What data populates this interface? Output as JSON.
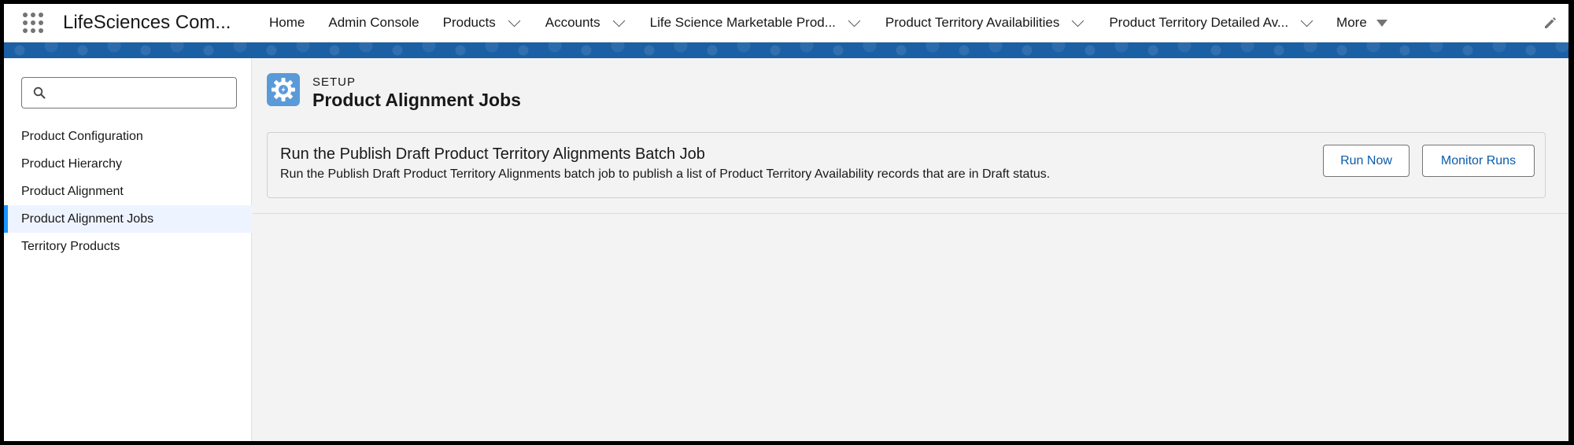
{
  "app": {
    "name": "LifeSciences Com..."
  },
  "nav": {
    "items": [
      {
        "label": "Home",
        "has_menu": false
      },
      {
        "label": "Admin Console",
        "has_menu": false
      },
      {
        "label": "Products",
        "has_menu": true
      },
      {
        "label": "Accounts",
        "has_menu": true
      },
      {
        "label": "Life Science Marketable Prod...",
        "has_menu": true
      },
      {
        "label": "Product Territory Availabilities",
        "has_menu": true
      },
      {
        "label": "Product Territory Detailed Av...",
        "has_menu": true
      }
    ],
    "more_label": "More"
  },
  "sidebar": {
    "search": {
      "value": "",
      "placeholder": ""
    },
    "items": [
      {
        "label": "Product Configuration"
      },
      {
        "label": "Product Hierarchy"
      },
      {
        "label": "Product Alignment"
      },
      {
        "label": "Product Alignment Jobs"
      },
      {
        "label": "Territory Products"
      }
    ],
    "active_index": 3
  },
  "header": {
    "eyebrow": "SETUP",
    "title": "Product Alignment Jobs"
  },
  "job": {
    "title": "Run the Publish Draft Product Territory Alignments Batch Job",
    "description": "Run the Publish Draft Product Territory Alignments batch job to publish a list of Product Territory Availability records that are in Draft status.",
    "run_now_label": "Run Now",
    "monitor_runs_label": "Monitor Runs"
  },
  "colors": {
    "brand_band": "#1b5fa5",
    "active_indicator": "#1b96ff",
    "button_text": "#0b5cab",
    "setup_icon_bg": "#5b9ad8"
  },
  "icons": {
    "app_launcher": "app-launcher-icon",
    "search": "search-icon",
    "edit": "pencil-icon",
    "setup": "gear-icon"
  }
}
